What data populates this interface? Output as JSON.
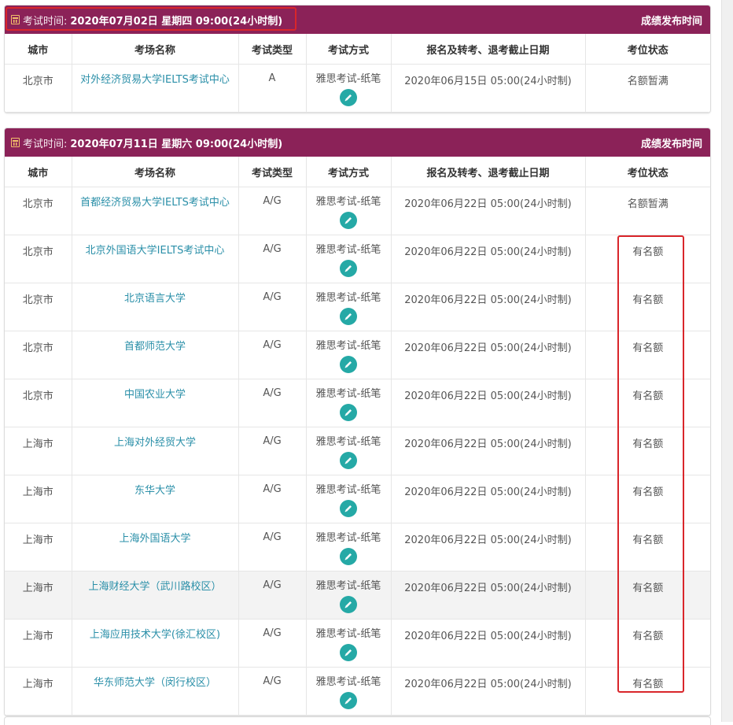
{
  "columns": {
    "city": "城市",
    "venue": "考场名称",
    "type": "考试类型",
    "method": "考试方式",
    "deadline": "报名及转考、退考截止日期",
    "status": "考位状态"
  },
  "sessions": [
    {
      "exam_label": "考试时间:",
      "exam_date": "2020年07月02日 星期四 09:00(24小时制)",
      "results_link": "成绩发布时间",
      "rows": [
        {
          "city": "北京市",
          "venue": "对外经济贸易大学IELTS考试中心",
          "type": "A",
          "method": "雅思考试-纸笔",
          "deadline": "2020年06月15日 05:00(24小时制)",
          "status": "名额暂满"
        }
      ]
    },
    {
      "exam_label": "考试时间:",
      "exam_date": "2020年07月11日 星期六 09:00(24小时制)",
      "results_link": "成绩发布时间",
      "rows": [
        {
          "city": "北京市",
          "venue": "首都经济贸易大学IELTS考试中心",
          "type": "A/G",
          "method": "雅思考试-纸笔",
          "deadline": "2020年06月22日 05:00(24小时制)",
          "status": "名额暂满"
        },
        {
          "city": "北京市",
          "venue": "北京外国语大学IELTS考试中心",
          "type": "A/G",
          "method": "雅思考试-纸笔",
          "deadline": "2020年06月22日 05:00(24小时制)",
          "status": "有名额"
        },
        {
          "city": "北京市",
          "venue": "北京语言大学",
          "type": "A/G",
          "method": "雅思考试-纸笔",
          "deadline": "2020年06月22日 05:00(24小时制)",
          "status": "有名额"
        },
        {
          "city": "北京市",
          "venue": "首都师范大学",
          "type": "A/G",
          "method": "雅思考试-纸笔",
          "deadline": "2020年06月22日 05:00(24小时制)",
          "status": "有名额"
        },
        {
          "city": "北京市",
          "venue": "中国农业大学",
          "type": "A/G",
          "method": "雅思考试-纸笔",
          "deadline": "2020年06月22日 05:00(24小时制)",
          "status": "有名额"
        },
        {
          "city": "上海市",
          "venue": "上海对外经贸大学",
          "type": "A/G",
          "method": "雅思考试-纸笔",
          "deadline": "2020年06月22日 05:00(24小时制)",
          "status": "有名额"
        },
        {
          "city": "上海市",
          "venue": "东华大学",
          "type": "A/G",
          "method": "雅思考试-纸笔",
          "deadline": "2020年06月22日 05:00(24小时制)",
          "status": "有名额"
        },
        {
          "city": "上海市",
          "venue": "上海外国语大学",
          "type": "A/G",
          "method": "雅思考试-纸笔",
          "deadline": "2020年06月22日 05:00(24小时制)",
          "status": "有名额"
        },
        {
          "city": "上海市",
          "venue": "上海财经大学（武川路校区）",
          "type": "A/G",
          "method": "雅思考试-纸笔",
          "deadline": "2020年06月22日 05:00(24小时制)",
          "status": "有名额"
        },
        {
          "city": "上海市",
          "venue": "上海应用技术大学(徐汇校区)",
          "type": "A/G",
          "method": "雅思考试-纸笔",
          "deadline": "2020年06月22日 05:00(24小时制)",
          "status": "有名额"
        },
        {
          "city": "上海市",
          "venue": "华东师范大学（闵行校区）",
          "type": "A/G",
          "method": "雅思考试-纸笔",
          "deadline": "2020年06月22日 05:00(24小时制)",
          "status": "有名额"
        }
      ]
    }
  ],
  "icons": {
    "calendar": "calendar-icon",
    "edit": "pencil-icon"
  },
  "colors": {
    "header_bg": "#8b2258",
    "venue_link": "#2a8fa8",
    "edit_button": "#25a9a6",
    "annotation_red": "#d9262b"
  }
}
